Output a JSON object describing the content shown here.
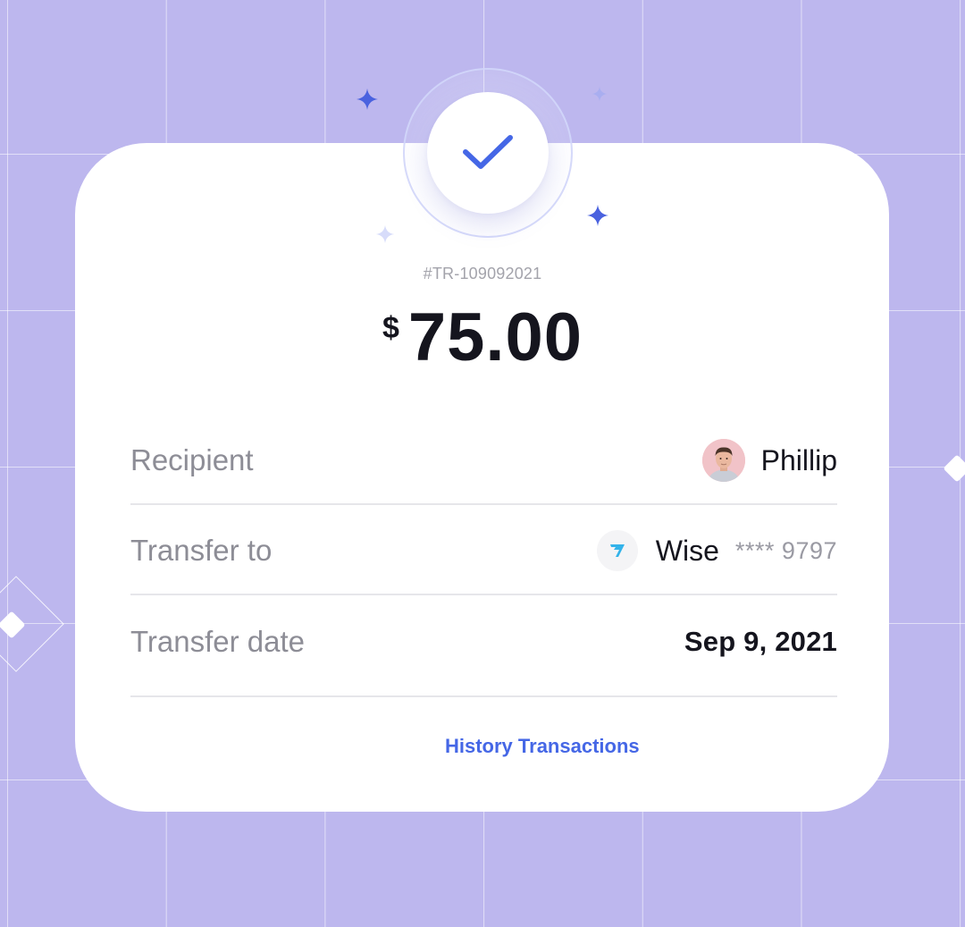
{
  "transaction": {
    "reference": "#TR-109092021",
    "currency_symbol": "$",
    "amount": "75.00"
  },
  "details": {
    "recipient": {
      "label": "Recipient",
      "name": "Phillip"
    },
    "transfer_to": {
      "label": "Transfer to",
      "provider": "Wise",
      "account_masked": "**** 9797"
    },
    "transfer_date": {
      "label": "Transfer date",
      "value": "Sep 9, 2021"
    }
  },
  "actions": {
    "history_label": "History Transactions"
  },
  "colors": {
    "background": "#bdb7ee",
    "card": "#ffffff",
    "accent": "#4567e6",
    "text_primary": "#15151e",
    "text_secondary": "#8d8d96"
  },
  "icons": {
    "status": "checkmark-icon",
    "provider": "wise-logo-icon",
    "decor": "sparkle-icon"
  }
}
